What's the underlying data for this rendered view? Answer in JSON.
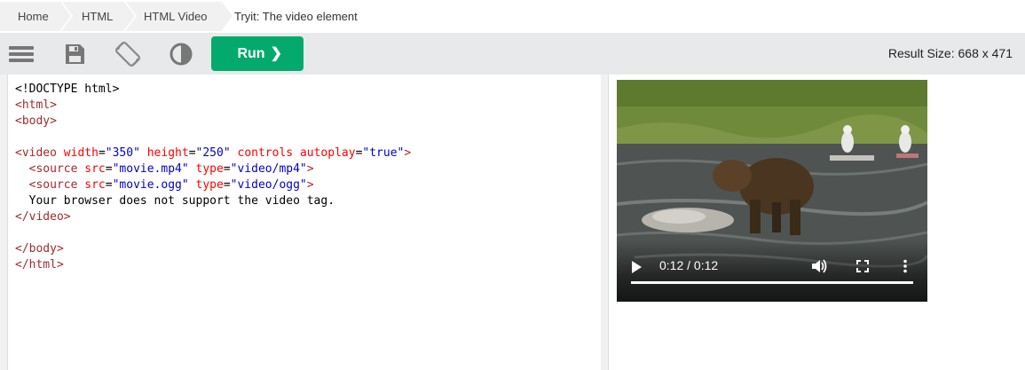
{
  "breadcrumb": {
    "items": [
      "Home",
      "HTML",
      "HTML Video"
    ],
    "current": "Tryit: The video element"
  },
  "toolbar": {
    "icons": [
      "menu-icon",
      "save-icon",
      "rotate-icon",
      "contrast-icon"
    ],
    "run_label": "Run",
    "run_chevron": "❯",
    "result_size": "Result Size: 668 x 471"
  },
  "code": {
    "lines": [
      "<!DOCTYPE html>",
      "<html>",
      "<body>",
      "",
      "<video width=\"350\" height=\"250\" controls autoplay=\"true\">",
      "  <source src=\"movie.mp4\" type=\"video/mp4\">",
      "  <source src=\"movie.ogg\" type=\"video/ogg\">",
      "  Your browser does not support the video tag.",
      "</video>",
      "",
      "</body>",
      "</html>"
    ]
  },
  "video": {
    "time_display": "0:12 / 0:12",
    "progress": 1.0,
    "controls": [
      "play-icon",
      "volume-icon",
      "fullscreen-icon",
      "more-options-icon"
    ]
  },
  "colors": {
    "run_button": "#04aa6d",
    "toolbar_bg": "#e7e9eb",
    "tag": "#a52a2a",
    "attr": "#ff0000",
    "value": "#0000cd"
  }
}
